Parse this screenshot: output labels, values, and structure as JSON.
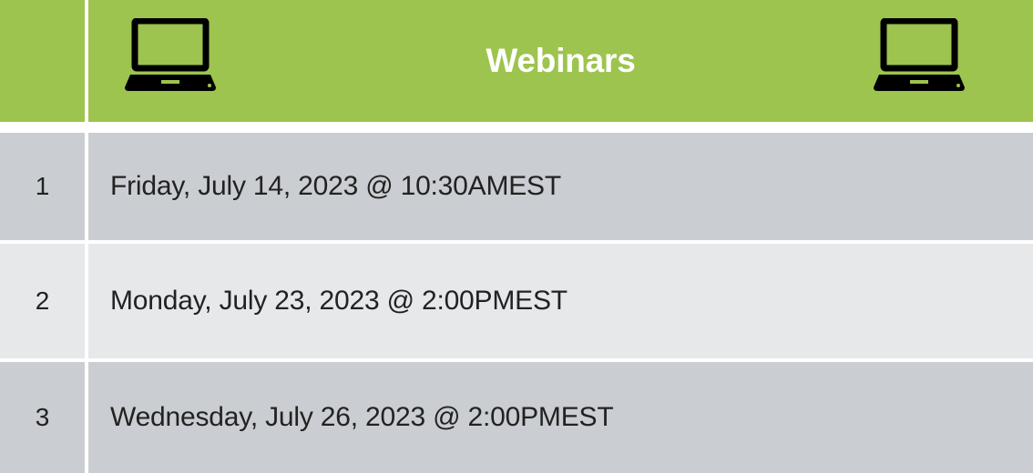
{
  "header": {
    "title": "Webinars",
    "left_icon": "laptop-icon",
    "right_icon": "laptop-icon",
    "color": "#9dc44e"
  },
  "rows": [
    {
      "num": "1",
      "text": "Friday, July 14, 2023 @ 10:30AMEST"
    },
    {
      "num": "2",
      "text": "Monday, July 23, 2023 @ 2:00PMEST"
    },
    {
      "num": "3",
      "text": "Wednesday, July 26, 2023 @ 2:00PMEST"
    }
  ],
  "colors": {
    "row_dark": "#cacdd1",
    "row_light": "#e7e8ea",
    "text": "#222222"
  }
}
